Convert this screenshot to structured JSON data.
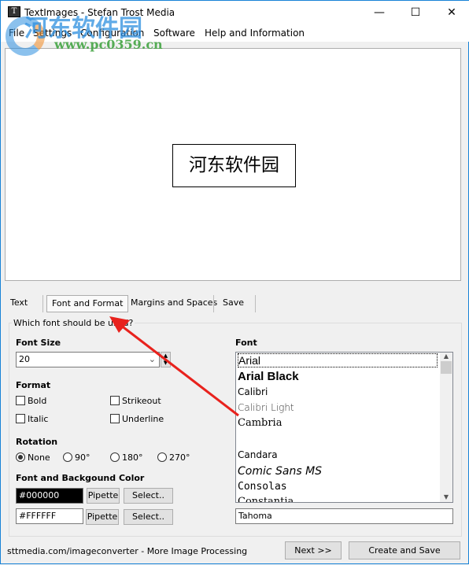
{
  "window": {
    "title": "TextImages - Stefan Trost Media",
    "icon": "T",
    "minimize": "—",
    "maximize": "☐",
    "close": "✕"
  },
  "menu": [
    "File",
    "Settings",
    "Configuration",
    "Software",
    "Help and Information"
  ],
  "preview": {
    "text": "河东软件园"
  },
  "tabs": [
    "Text",
    "Font and Format",
    "Margins and Spaces",
    "Save"
  ],
  "active_tab": "Font and Format",
  "group": {
    "label": "Which font should be used?"
  },
  "font_size": {
    "label": "Font Size",
    "value": "20"
  },
  "format": {
    "label": "Format",
    "bold": "Bold",
    "strikeout": "Strikeout",
    "italic": "Italic",
    "underline": "Underline"
  },
  "rotation": {
    "label": "Rotation",
    "options": [
      "None",
      "90°",
      "180°",
      "270°"
    ],
    "selected": "None"
  },
  "colors": {
    "label": "Font and Backgound Color",
    "font_color": "#000000",
    "bg_color": "#FFFFFF",
    "pipette": "Pipette",
    "select": "Select.."
  },
  "font": {
    "label": "Font",
    "items": [
      "Arial",
      "Arial Black",
      "Calibri",
      "Calibri Light",
      "Cambria",
      "",
      "Candara",
      "Comic Sans MS",
      "Consolas",
      "Constantia"
    ],
    "selected": "Arial",
    "custom": "Tahoma"
  },
  "footer": {
    "link": "sttmedia.com/imageconverter - More Image Processing",
    "next": "Next >>",
    "create": "Create and Save"
  },
  "watermark": {
    "text": "河东软件园",
    "url": "www.pc0359.cn"
  },
  "annotation_color": "#e8221d"
}
